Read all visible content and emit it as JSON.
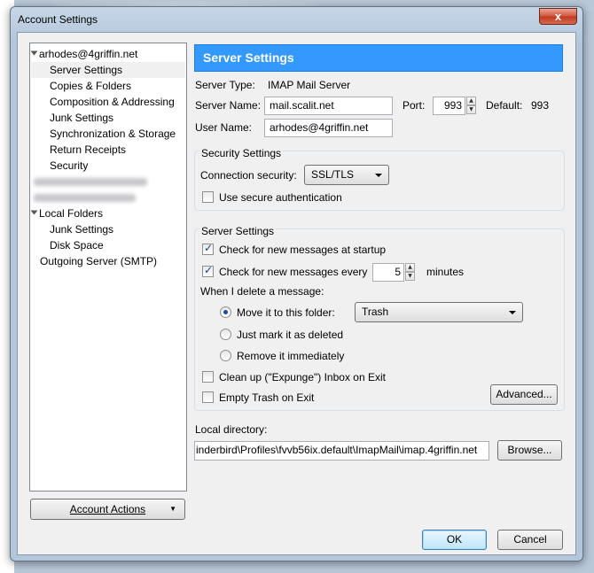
{
  "window": {
    "title": "Account Settings",
    "close_symbol": "x"
  },
  "tree": {
    "account": "arhodes@4griffin.net",
    "account_items": [
      "Server Settings",
      "Copies & Folders",
      "Composition & Addressing",
      "Junk Settings",
      "Synchronization & Storage",
      "Return Receipts",
      "Security"
    ],
    "local_folders": "Local Folders",
    "local_items": [
      "Junk Settings",
      "Disk Space"
    ],
    "outgoing": "Outgoing Server (SMTP)"
  },
  "account_actions": {
    "label": "Account Actions"
  },
  "panel": {
    "title": "Server Settings",
    "server_type_label": "Server Type:",
    "server_type_value": "IMAP Mail Server",
    "server_name_label": "Server Name:",
    "server_name_value": "mail.scalit.net",
    "port_label": "Port:",
    "port_value": "993",
    "default_label": "Default:",
    "default_value": "993",
    "user_name_label": "User Name:",
    "user_name_value": "arhodes@4griffin.net"
  },
  "security": {
    "group_label": "Security Settings",
    "connection_label": "Connection security:",
    "connection_value": "SSL/TLS",
    "secure_auth_label": "Use secure authentication",
    "secure_auth_checked": false
  },
  "server": {
    "group_label": "Server Settings",
    "check_startup_label": "Check for new messages at startup",
    "check_startup_checked": true,
    "check_every_label": "Check for new messages every",
    "check_every_checked": true,
    "check_every_value": "5",
    "minutes_label": "minutes",
    "delete_label": "When I delete a message:",
    "move_label": "Move it to this folder:",
    "move_selected": true,
    "folder_value": "Trash",
    "mark_label": "Just mark it as deleted",
    "remove_label": "Remove it immediately",
    "cleanup_label": "Clean up (\"Expunge\") Inbox on Exit",
    "cleanup_checked": false,
    "empty_trash_label": "Empty Trash on Exit",
    "empty_trash_checked": false,
    "advanced_label": "Advanced..."
  },
  "local_dir": {
    "label": "Local directory:",
    "path": "inderbird\\Profiles\\fvvb56ix.default\\ImapMail\\imap.4griffin.net",
    "browse_label": "Browse..."
  },
  "footer": {
    "ok_label": "OK",
    "cancel_label": "Cancel"
  },
  "colors": {
    "header": "#3399ff",
    "frame": "#b3c6da"
  }
}
